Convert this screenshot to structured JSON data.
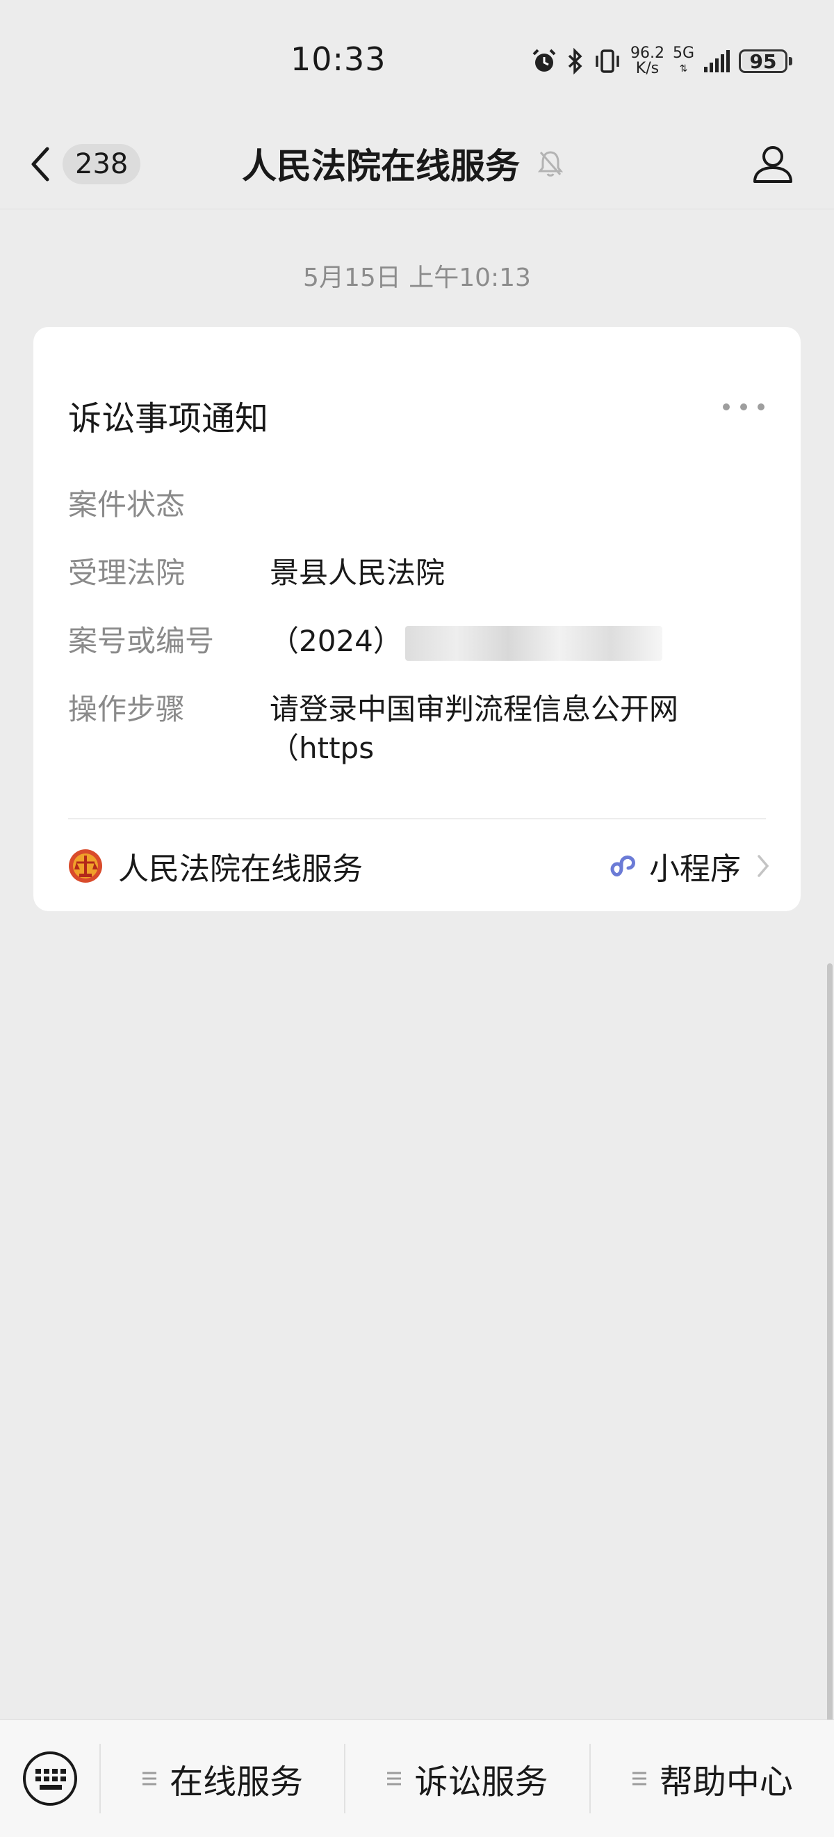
{
  "status_bar": {
    "time": "10:33",
    "net_speed_value": "96.2",
    "net_speed_unit": "K/s",
    "network": "5G",
    "battery": "95"
  },
  "nav": {
    "unread_count": "238",
    "title": "人民法院在线服务"
  },
  "chat": {
    "timestamp": "5月15日 上午10:13"
  },
  "card": {
    "title": "诉讼事项通知",
    "fields": [
      {
        "label": "案件状态",
        "value": ""
      },
      {
        "label": "受理法院",
        "value": "景县人民法院"
      },
      {
        "label": "案号或编号",
        "value": "（2024）"
      },
      {
        "label": "操作步骤",
        "value": "请登录中国审判流程信息公开网（https"
      }
    ],
    "footer_name": "人民法院在线服务",
    "mini_program_label": "小程序"
  },
  "bottom_menu": {
    "items": [
      {
        "label": "在线服务"
      },
      {
        "label": "诉讼服务"
      },
      {
        "label": "帮助中心"
      }
    ]
  },
  "colors": {
    "background": "#ececec",
    "card": "#ffffff",
    "label_gray": "#8a8a8a",
    "link_icon": "#6b7bd6",
    "court_red": "#d94b2b"
  }
}
